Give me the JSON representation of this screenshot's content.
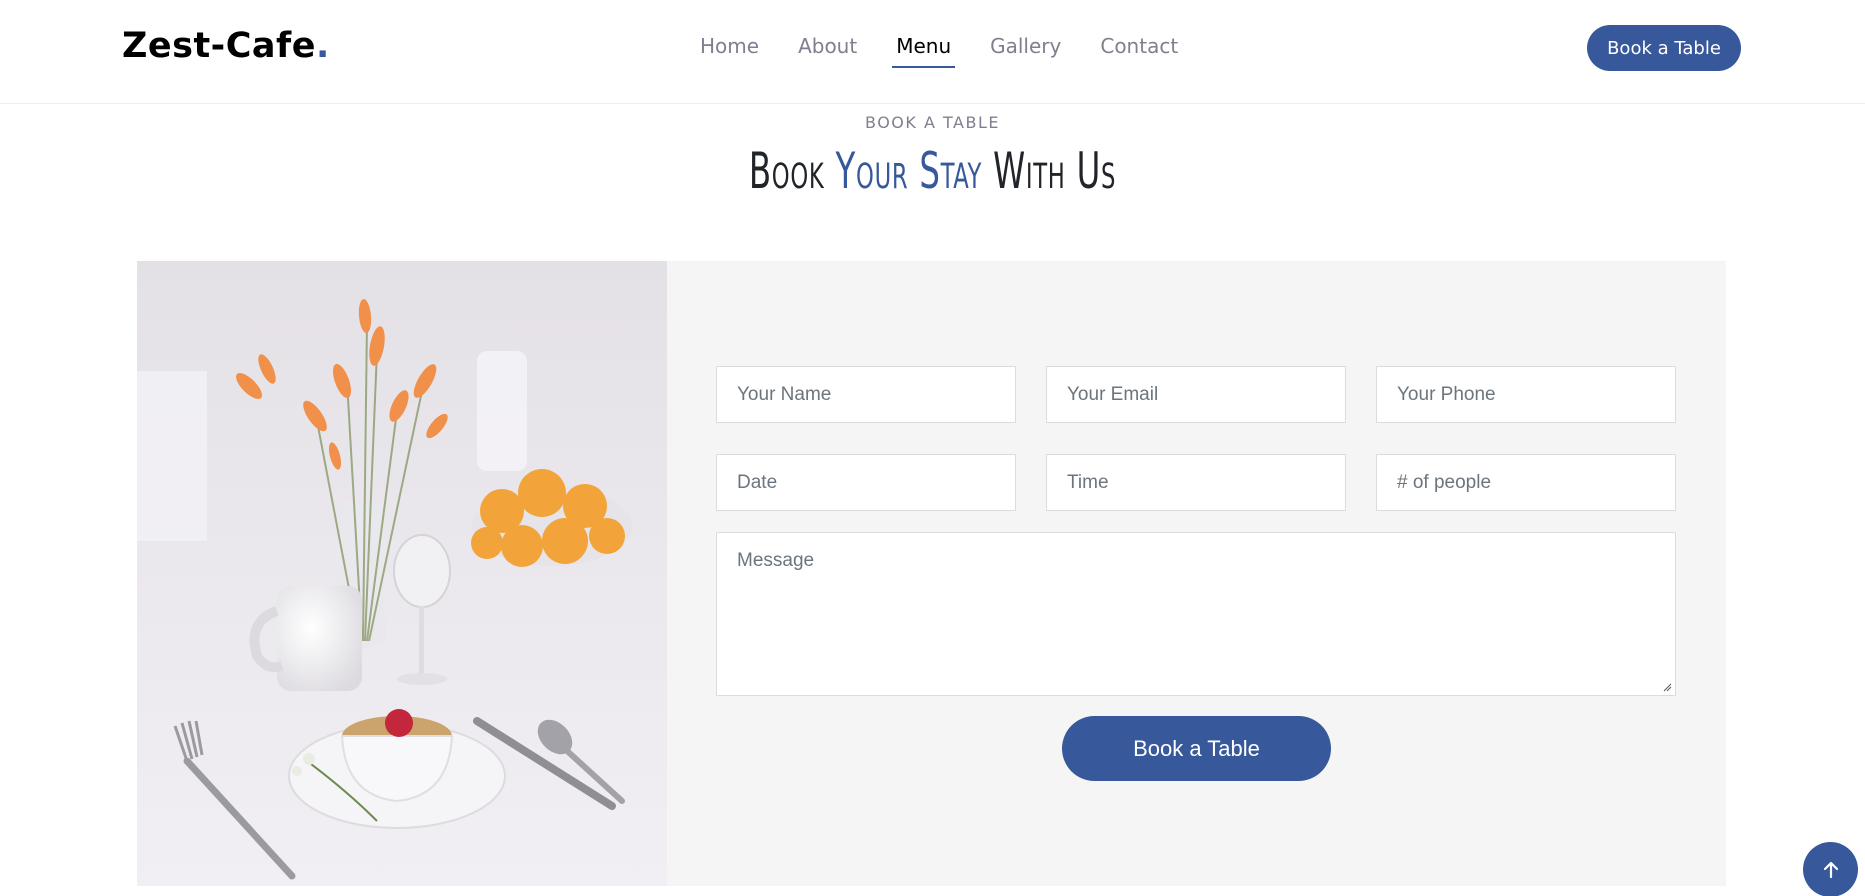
{
  "header": {
    "logo_text": "Zest-Cafe",
    "logo_dot": ".",
    "nav": [
      {
        "label": "Home",
        "active": false
      },
      {
        "label": "About",
        "active": false
      },
      {
        "label": "Menu",
        "active": true
      },
      {
        "label": "Gallery",
        "active": false
      },
      {
        "label": "Contact",
        "active": false
      }
    ],
    "cta_label": "Book a Table"
  },
  "section": {
    "eyebrow": "BOOK A TABLE",
    "title_part1": "Book ",
    "title_accent": "Your Stay",
    "title_part2": " With Us"
  },
  "form": {
    "name_placeholder": "Your Name",
    "email_placeholder": "Your Email",
    "phone_placeholder": "Your Phone",
    "date_placeholder": "Date",
    "time_placeholder": "Time",
    "people_placeholder": "# of people",
    "message_placeholder": "Message",
    "submit_label": "Book a Table"
  },
  "colors": {
    "accent": "#37589b",
    "panel_bg": "#f5f5f5",
    "muted_text": "#7f7f90"
  },
  "icons": {
    "back_to_top": "arrow-up-icon"
  }
}
